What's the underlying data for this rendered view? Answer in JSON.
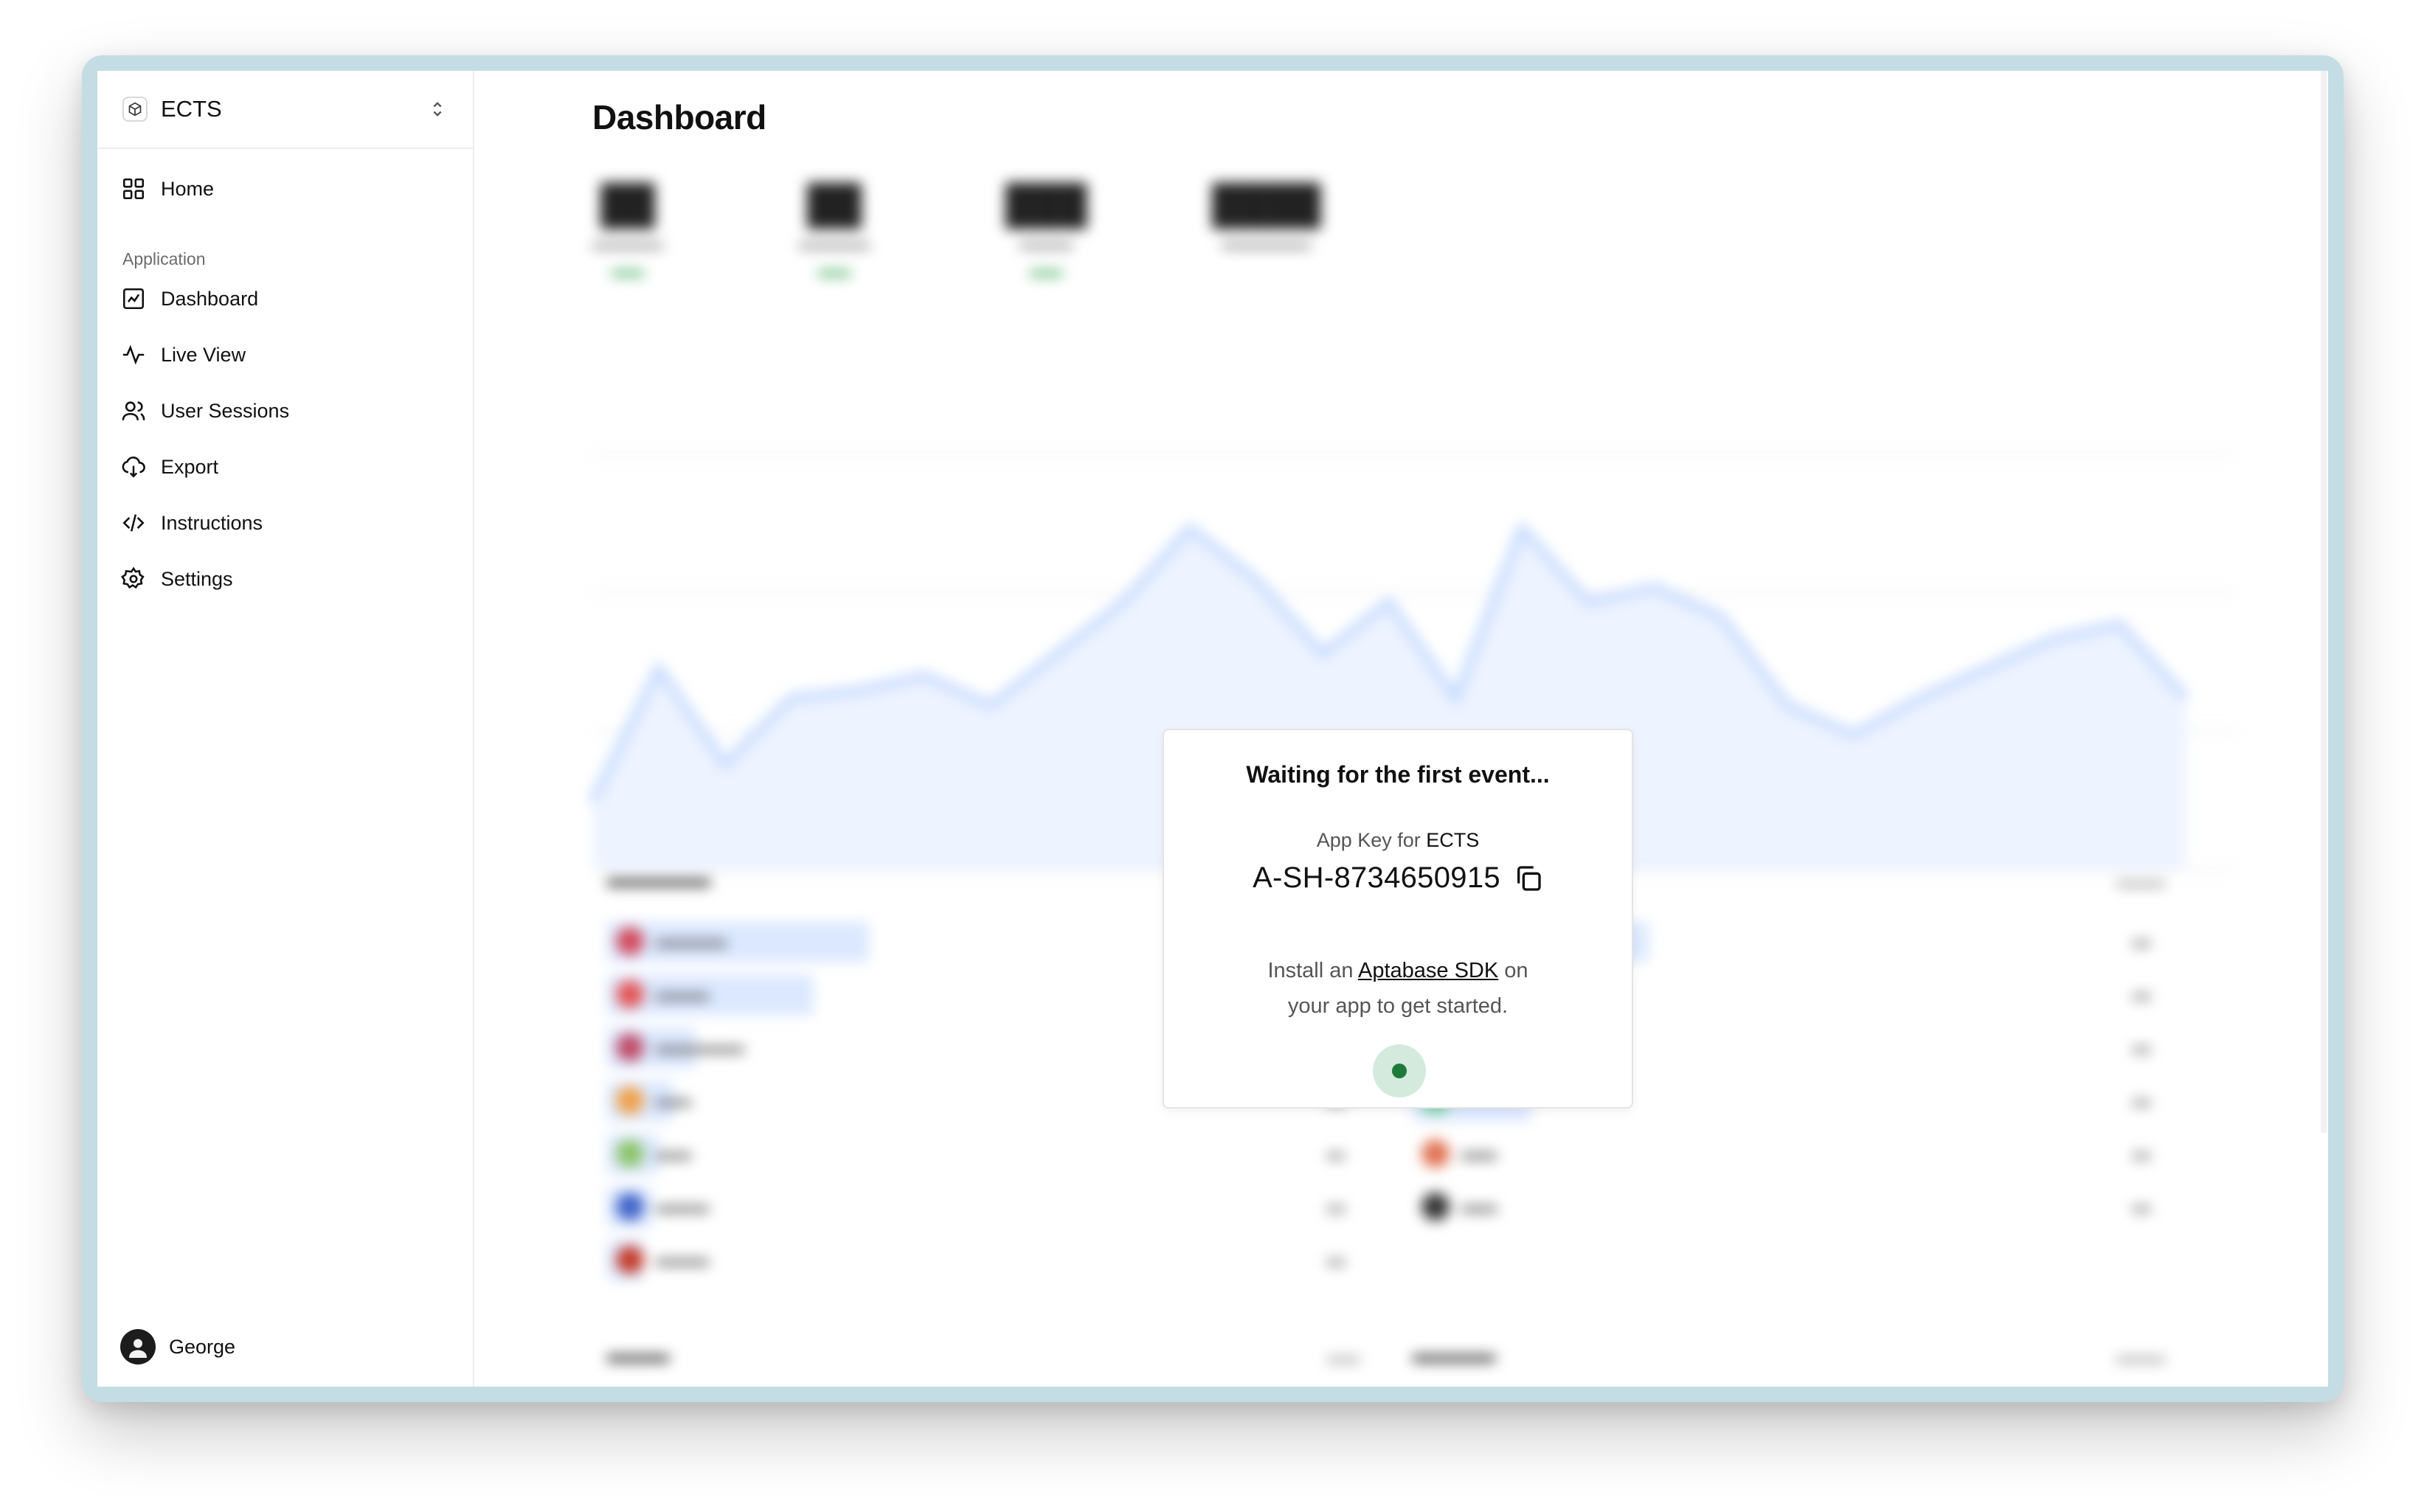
{
  "sidebar": {
    "app_name": "ECTS",
    "home_label": "Home",
    "section_label": "Application",
    "items": [
      {
        "label": "Dashboard",
        "icon": "chart-icon"
      },
      {
        "label": "Live View",
        "icon": "activity-icon"
      },
      {
        "label": "User Sessions",
        "icon": "users-icon"
      },
      {
        "label": "Export",
        "icon": "cloud-download-icon"
      },
      {
        "label": "Instructions",
        "icon": "code-icon"
      },
      {
        "label": "Settings",
        "icon": "gear-icon"
      }
    ],
    "user_name": "George"
  },
  "main": {
    "title": "Dashboard"
  },
  "modal": {
    "title": "Waiting for the first event...",
    "key_label_prefix": "App Key for",
    "key_label_app": "ECTS",
    "app_key": "A-SH-8734650915",
    "install_prefix": "Install an",
    "install_link": "Aptabase SDK",
    "install_suffix": "on",
    "install_line2": "your app to get started.",
    "status_color": "#1d7a3a"
  },
  "colors": {
    "accent_blue": "#a9c8ff",
    "delta_green": "#2aa14a",
    "frame": "#c4dde4"
  }
}
